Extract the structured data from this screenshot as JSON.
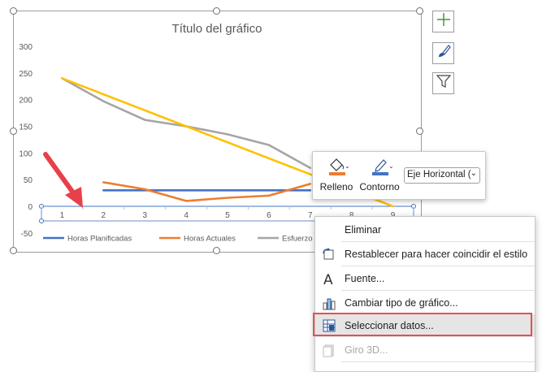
{
  "chart_data": {
    "type": "line",
    "title": "Título del gráfico",
    "categories": [
      "1",
      "2",
      "3",
      "4",
      "5",
      "6",
      "7",
      "8",
      "9"
    ],
    "y_ticks": [
      "300",
      "250",
      "200",
      "150",
      "100",
      "50",
      "0",
      "-50"
    ],
    "ylim": [
      -50,
      300
    ],
    "series": [
      {
        "name": "Horas Planificadas",
        "color": "#4472c4",
        "values": [
          null,
          30,
          30,
          30,
          30,
          30,
          30,
          null,
          null
        ]
      },
      {
        "name": "Horas Actuales",
        "color": "#ed7d31",
        "values": [
          null,
          45,
          32,
          10,
          16,
          20,
          42,
          null,
          null
        ]
      },
      {
        "name": "Esfuerzo Restante",
        "color": "#a5a5a5",
        "values": [
          240,
          197,
          162,
          150,
          135,
          115,
          72,
          null,
          null
        ]
      },
      {
        "name": "",
        "color": "#ffc000",
        "values": [
          240,
          210,
          180,
          150,
          120,
          90,
          60,
          30,
          0
        ]
      }
    ],
    "legend": "bottom",
    "grid": false
  },
  "side_buttons": [
    {
      "icon": "chart-elements-plus-icon"
    },
    {
      "icon": "chart-styles-brush-icon"
    },
    {
      "icon": "chart-filter-icon"
    }
  ],
  "mini_toolbar": {
    "fill_label": "Relleno",
    "outline_label": "Contorno",
    "axis_select_value": "Eje Horizontal (",
    "colors": {
      "fill": "#ed7d31",
      "outline": "#4472c4"
    }
  },
  "context_menu": {
    "items": [
      {
        "label": "Eliminar",
        "icon": "none",
        "enabled": true
      },
      {
        "label": "Restablecer para hacer coincidir el estilo",
        "icon": "reset-style-icon",
        "enabled": true
      },
      {
        "label": "Fuente...",
        "icon": "font-icon",
        "enabled": true
      },
      {
        "label": "Cambiar tipo de gráfico...",
        "icon": "chart-type-icon",
        "enabled": true
      },
      {
        "label": "Seleccionar datos...",
        "icon": "select-data-icon",
        "enabled": true,
        "highlighted": true
      },
      {
        "label": "Giro 3D...",
        "icon": "rotate-3d-icon",
        "enabled": false
      }
    ]
  }
}
